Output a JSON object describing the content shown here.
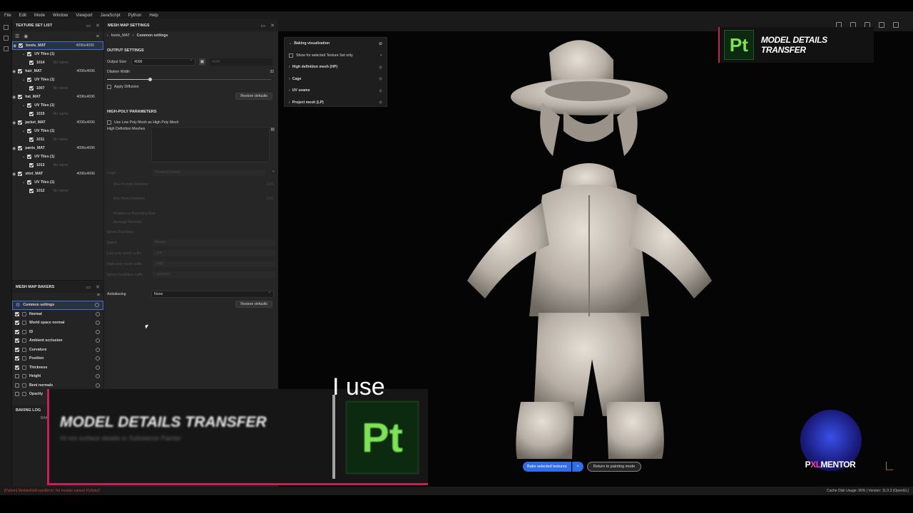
{
  "menu": [
    "File",
    "Edit",
    "Mode",
    "Window",
    "Viewport",
    "JavaScript",
    "Python",
    "Help"
  ],
  "texture_set_list": {
    "title": "TEXTURE SET LIST",
    "materials": [
      {
        "name": "boots_MAT",
        "res": "4096x4096",
        "tile": "UV Tiles (1)",
        "udim": "1014",
        "noname": "No name"
      },
      {
        "name": "hair_MAT",
        "res": "4096x4096",
        "tile": "UV Tiles (1)",
        "udim": "1007",
        "noname": "No name"
      },
      {
        "name": "hat_MAT",
        "res": "4096x4096",
        "tile": "UV Tiles (1)",
        "udim": "1015",
        "noname": "No name"
      },
      {
        "name": "jacket_MAT",
        "res": "4096x4096",
        "tile": "UV Tiles (1)",
        "udim": "1011",
        "noname": "No name"
      },
      {
        "name": "pants_MAT",
        "res": "4096x4096",
        "tile": "UV Tiles (1)",
        "udim": "1013",
        "noname": "No name"
      },
      {
        "name": "shirt_MAT",
        "res": "4096x4096",
        "tile": "UV Tiles (1)",
        "udim": "1012",
        "noname": "No name"
      }
    ]
  },
  "mesh_map_settings": {
    "title": "MESH MAP SETTINGS",
    "breadcrumb": [
      "boots_MAT",
      "Common settings"
    ],
    "output_settings": "OUTPUT SETTINGS",
    "output_size_label": "Output Size",
    "output_size_value": "4096",
    "output_size_linked": "4096",
    "dilation_label": "Dilation Width",
    "dilation_value": "32",
    "dilation_fraction": 0.26,
    "apply_diffusion": "Apply Diffusion",
    "restore_defaults": "Restore defaults",
    "high_poly": "HIGH-POLY PARAMETERS",
    "use_low_poly": "Use Low Poly Mesh as High Poly Mesh",
    "hd_meshes": "High Definition Meshes",
    "cage": "Cage",
    "cage_value": "Distance-based",
    "max_frontal": "Max Frontal Distance",
    "max_frontal_value": "0.01",
    "max_rear": "Max Rear Distance",
    "max_rear_value": "0.01",
    "relative_bbox": "Relative to Bounding Box",
    "average_normals": "Average Normals",
    "ignore_backface": "Ignore Backface",
    "match": "Match",
    "match_value": "Always",
    "low_suffix": "Low poly mesh suffix",
    "low_suffix_value": "_low",
    "high_suffix": "High poly mesh suffix",
    "high_suffix_value": "_high",
    "ignore_suffix": "Ignore backface suffix",
    "ignore_suffix_value": "_ignorebf",
    "antialiasing": "Antialiasing",
    "antialiasing_value": "None",
    "restore_defaults_2": "Restore defaults"
  },
  "mesh_map_bakers": {
    "title": "MESH MAP BAKERS",
    "common": "Common settings",
    "items": [
      {
        "label": "Normal",
        "on": true
      },
      {
        "label": "World space normal",
        "on": true
      },
      {
        "label": "ID",
        "on": true
      },
      {
        "label": "Ambient occlusion",
        "on": true
      },
      {
        "label": "Curvature",
        "on": true
      },
      {
        "label": "Position",
        "on": true
      },
      {
        "label": "Thickness",
        "on": true
      },
      {
        "label": "Height",
        "on": false
      },
      {
        "label": "Bent normals",
        "on": false
      },
      {
        "label": "Opacity",
        "on": false
      }
    ]
  },
  "baking_log": {
    "title": "BAKING LOG",
    "sub": "BAK"
  },
  "baking_vis": {
    "title": "Baking visualization",
    "show_for": "Show for selected Texture Set only",
    "rows": [
      "High definition mesh (HP)",
      "Cage",
      "UV seams",
      "Project mesh (LP)"
    ]
  },
  "bake_buttons": {
    "bake": "Bake selected textures",
    "return": "Return to painting mode"
  },
  "status": {
    "error": "[Python] ModuleNotFoundError: No module named 'PySide2'",
    "info": "Cache Disk Usage:    95% | Version: 11.0.3 (OpenGL)"
  },
  "overlay": {
    "badge_logo": "Pt",
    "badge_title": "MODEL DETAILS TRANSFER",
    "caption": "I use",
    "lower_title": "MODEL DETAILS TRANSFER",
    "lower_sub": "Hi-res surface details in Substance Painter",
    "lower_logo": "Pt",
    "pxl_a": "P",
    "pxl_b": "XL",
    "pxl_c": "MENTOR"
  },
  "colors": {
    "accent": "#2f6ee6",
    "brand": "#c81e5a",
    "pt_green": "#7ee257"
  }
}
